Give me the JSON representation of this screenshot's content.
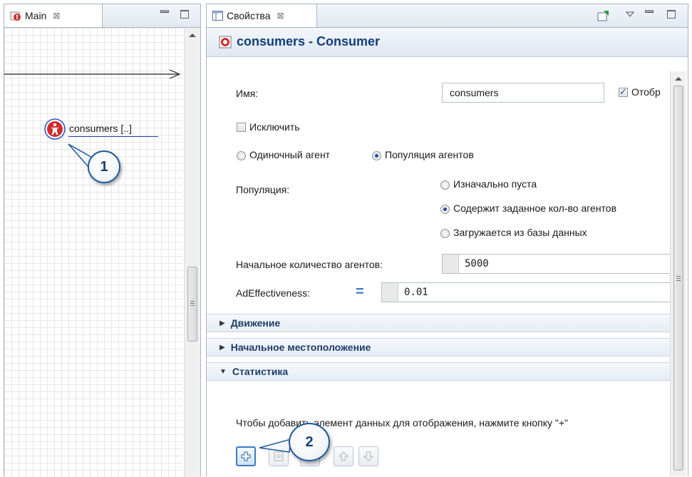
{
  "left_view": {
    "tab_label": "Main",
    "tab_close": "⊠",
    "agent_label": "consumers [..]",
    "callout_1": "1"
  },
  "properties_view": {
    "tab_label": "Свойства",
    "tab_close": "⊠",
    "title": "consumers - Consumer",
    "name_label": "Имя:",
    "name_value": "consumers",
    "show_name_label": "Отобр",
    "exclude_label": "Исключить",
    "single_agent_label": "Одиночный агент",
    "population_label": "Популяция агентов",
    "population_field_label": "Популяция:",
    "pop_options": [
      {
        "label": "Изначально пуста",
        "selected": false
      },
      {
        "label": "Содержит заданное кол-во агентов",
        "selected": true
      },
      {
        "label": "Загружается из базы данных",
        "selected": false
      }
    ],
    "initial_count_label": "Начальное количество агентов:",
    "initial_count_value": "5000",
    "param_label": "AdEffectiveness:",
    "param_eq": "=",
    "param_value": "0.01",
    "sections": [
      {
        "label": "Движение",
        "expanded": false
      },
      {
        "label": "Начальное местоположение",
        "expanded": false
      },
      {
        "label": "Статистика",
        "expanded": true
      }
    ],
    "stats_hint": "Чтобы добавить элемент данных для отображения, нажмите кнопку \"+\"",
    "callout_2": "2",
    "toolbar_buttons": [
      "add",
      "details",
      "delete",
      "move-up",
      "move-down"
    ]
  },
  "colors": {
    "accent": "#1d4f91",
    "agent_icon": "#d42b2b",
    "header_text": "#123e78"
  }
}
